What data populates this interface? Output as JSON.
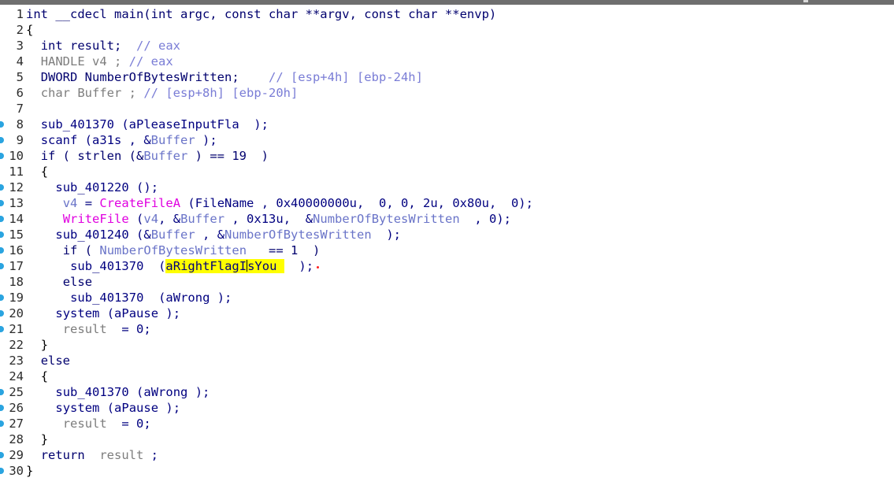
{
  "editor": {
    "lines": [
      {
        "n": "1",
        "bp": false,
        "indent": 0,
        "tokens": [
          [
            "kw",
            "int __cdecl main(int argc, const char **argv, const char **envp)"
          ]
        ]
      },
      {
        "n": "2",
        "bp": false,
        "indent": 0,
        "tokens": [
          [
            "plain",
            "{"
          ]
        ]
      },
      {
        "n": "3",
        "bp": false,
        "indent": 2,
        "tokens": [
          [
            "kw",
            "int result;  "
          ],
          [
            "cmt",
            "// eax"
          ]
        ]
      },
      {
        "n": "4",
        "bp": false,
        "indent": 2,
        "tokens": [
          [
            "lvar",
            "HANDLE v4 ; "
          ],
          [
            "cmt",
            "// eax"
          ]
        ]
      },
      {
        "n": "5",
        "bp": false,
        "indent": 2,
        "tokens": [
          [
            "kw",
            "DWORD NumberOfBytesWritten;    "
          ],
          [
            "cmt",
            "// [esp+4h] [ebp-24h]"
          ]
        ]
      },
      {
        "n": "6",
        "bp": false,
        "indent": 2,
        "tokens": [
          [
            "lvar",
            "char Buffer ; "
          ],
          [
            "cmt",
            "// [esp+8h] [ebp-20h]"
          ]
        ]
      },
      {
        "n": "7",
        "bp": false,
        "indent": 2,
        "tokens": []
      },
      {
        "n": "8",
        "bp": true,
        "indent": 2,
        "tokens": [
          [
            "fn",
            "sub_401370 (aPleaseInputFla  );"
          ]
        ]
      },
      {
        "n": "9",
        "bp": true,
        "indent": 2,
        "tokens": [
          [
            "fn",
            "scanf (a31s , &"
          ],
          [
            "var",
            "Buffer"
          ],
          [
            "fn",
            " );"
          ]
        ]
      },
      {
        "n": "10",
        "bp": true,
        "indent": 2,
        "tokens": [
          [
            "kw",
            "if ( strlen (&"
          ],
          [
            "var",
            "Buffer"
          ],
          [
            "kw",
            " ) == 19  )"
          ]
        ]
      },
      {
        "n": "11",
        "bp": false,
        "indent": 2,
        "tokens": [
          [
            "plain",
            "{"
          ]
        ]
      },
      {
        "n": "12",
        "bp": true,
        "indent": 4,
        "tokens": [
          [
            "fn",
            "sub_401220 ();"
          ]
        ]
      },
      {
        "n": "13",
        "bp": true,
        "indent": 4,
        "tokens": [
          [
            "var",
            " v4"
          ],
          [
            "fn",
            " = "
          ],
          [
            "imp",
            "CreateFileA"
          ],
          [
            "fn",
            " (FileName , 0x40000000u,  0, 0, 2u, 0x80u,  0);"
          ]
        ]
      },
      {
        "n": "14",
        "bp": true,
        "indent": 4,
        "tokens": [
          [
            "imp",
            " WriteFile"
          ],
          [
            "fn",
            " ("
          ],
          [
            "var",
            "v4"
          ],
          [
            "fn",
            ", &"
          ],
          [
            "var",
            "Buffer"
          ],
          [
            "fn",
            " , 0x13u,  &"
          ],
          [
            "var",
            "NumberOfBytesWritten"
          ],
          [
            "fn",
            "  , 0);"
          ]
        ]
      },
      {
        "n": "15",
        "bp": true,
        "indent": 4,
        "tokens": [
          [
            "fn",
            "sub_401240 (&"
          ],
          [
            "var",
            "Buffer"
          ],
          [
            "fn",
            " , &"
          ],
          [
            "var",
            "NumberOfBytesWritten"
          ],
          [
            "fn",
            "  );"
          ]
        ]
      },
      {
        "n": "16",
        "bp": true,
        "indent": 4,
        "tokens": [
          [
            "kw",
            " if ( "
          ],
          [
            "var",
            "NumberOfBytesWritten"
          ],
          [
            "kw",
            "   == 1  )"
          ]
        ]
      },
      {
        "n": "17",
        "bp": true,
        "indent": 6,
        "tokens": [
          [
            "fn",
            "sub_401370  ("
          ],
          [
            "hl",
            "aRightFlagIsYou "
          ],
          [
            "fn",
            "  );"
          ],
          [
            "dot",
            ""
          ]
        ]
      },
      {
        "n": "18",
        "bp": false,
        "indent": 4,
        "tokens": [
          [
            "kw",
            " else"
          ]
        ]
      },
      {
        "n": "19",
        "bp": true,
        "indent": 6,
        "tokens": [
          [
            "fn",
            "sub_401370  (aWrong );"
          ]
        ]
      },
      {
        "n": "20",
        "bp": true,
        "indent": 4,
        "tokens": [
          [
            "fn",
            "system (aPause );"
          ]
        ]
      },
      {
        "n": "21",
        "bp": true,
        "indent": 4,
        "tokens": [
          [
            "lvar",
            " result"
          ],
          [
            "fn",
            "  = 0;"
          ]
        ]
      },
      {
        "n": "22",
        "bp": false,
        "indent": 2,
        "tokens": [
          [
            "plain",
            "}"
          ]
        ]
      },
      {
        "n": "23",
        "bp": false,
        "indent": 2,
        "tokens": [
          [
            "kw",
            "else"
          ]
        ]
      },
      {
        "n": "24",
        "bp": false,
        "indent": 2,
        "tokens": [
          [
            "plain",
            "{"
          ]
        ]
      },
      {
        "n": "25",
        "bp": true,
        "indent": 4,
        "tokens": [
          [
            "fn",
            "sub_401370 (aWrong );"
          ]
        ]
      },
      {
        "n": "26",
        "bp": true,
        "indent": 4,
        "tokens": [
          [
            "fn",
            "system (aPause );"
          ]
        ]
      },
      {
        "n": "27",
        "bp": true,
        "indent": 4,
        "tokens": [
          [
            "lvar",
            " result"
          ],
          [
            "fn",
            "  = 0;"
          ]
        ]
      },
      {
        "n": "28",
        "bp": false,
        "indent": 2,
        "tokens": [
          [
            "plain",
            "}"
          ]
        ]
      },
      {
        "n": "29",
        "bp": true,
        "indent": 2,
        "tokens": [
          [
            "kw",
            "return  "
          ],
          [
            "lvar",
            "result"
          ],
          [
            "fn",
            " ;"
          ]
        ]
      },
      {
        "n": "30",
        "bp": true,
        "indent": 0,
        "tokens": [
          [
            "plain",
            "}"
          ]
        ]
      }
    ]
  },
  "colors": {
    "breakpoint": "#2aa4e0",
    "highlight": "#ffff00",
    "import_name": "#e000e0",
    "keyword": "#00006e",
    "comment": "#7a7dd6"
  }
}
